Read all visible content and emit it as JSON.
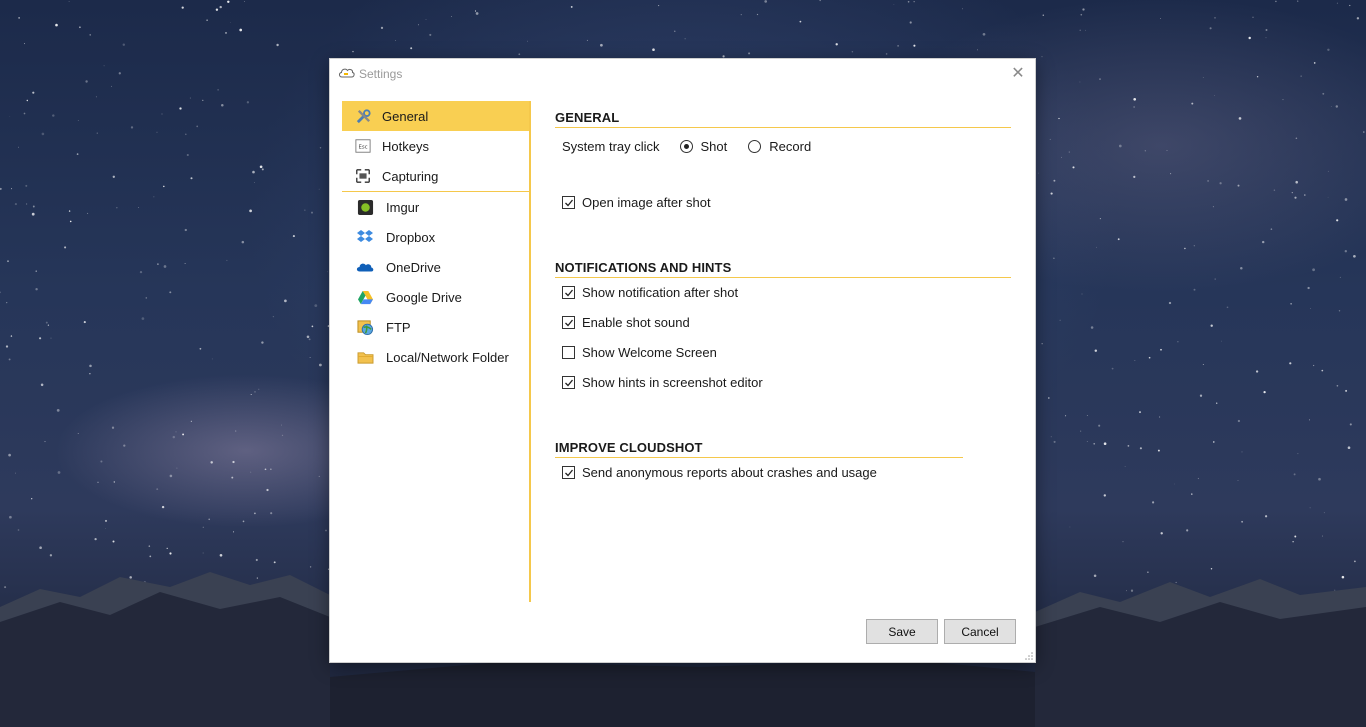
{
  "window": {
    "title": "Settings",
    "close_glyph": "✕"
  },
  "sidebar": {
    "groups": [
      [
        {
          "label": "General",
          "icon": "tools-icon",
          "active": true
        },
        {
          "label": "Hotkeys",
          "icon": "esc-key-icon",
          "active": false
        },
        {
          "label": "Capturing",
          "icon": "capture-frame-icon",
          "active": false
        }
      ],
      [
        {
          "label": "Imgur",
          "icon": "imgur-icon",
          "active": false
        },
        {
          "label": "Dropbox",
          "icon": "dropbox-icon",
          "active": false
        },
        {
          "label": "OneDrive",
          "icon": "onedrive-icon",
          "active": false
        },
        {
          "label": "Google Drive",
          "icon": "google-drive-icon",
          "active": false
        },
        {
          "label": "FTP",
          "icon": "ftp-globe-icon",
          "active": false
        },
        {
          "label": "Local/Network Folder",
          "icon": "folder-icon",
          "active": false
        }
      ]
    ]
  },
  "general": {
    "heading": "GENERAL",
    "tray_label": "System tray click",
    "tray_options": [
      {
        "label": "Shot",
        "selected": true
      },
      {
        "label": "Record",
        "selected": false
      }
    ],
    "open_image": {
      "label": "Open image after shot",
      "checked": true
    }
  },
  "notifications": {
    "heading": "NOTIFICATIONS AND HINTS",
    "items": [
      {
        "label": "Show notification after shot",
        "checked": true
      },
      {
        "label": "Enable shot sound",
        "checked": true
      },
      {
        "label": "Show Welcome Screen",
        "checked": false
      },
      {
        "label": "Show hints in screenshot editor",
        "checked": true
      }
    ]
  },
  "improve": {
    "heading": "IMPROVE CLOUDSHOT",
    "items": [
      {
        "label": "Send anonymous reports about crashes and usage",
        "checked": true
      }
    ]
  },
  "buttons": {
    "save": "Save",
    "cancel": "Cancel"
  },
  "colors": {
    "accent": "#f9cf52",
    "accent_line": "#f5c84b"
  }
}
